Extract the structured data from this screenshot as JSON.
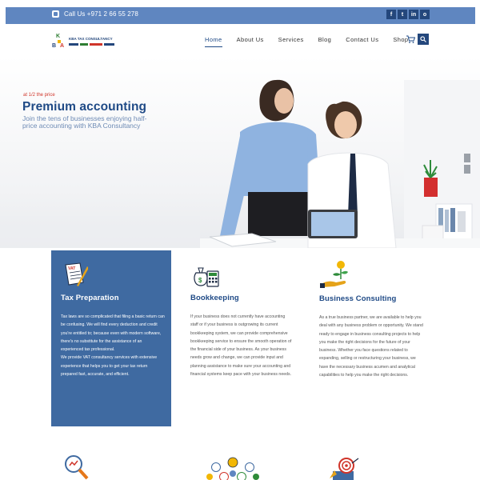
{
  "topbar": {
    "phone": "Call Us +971 2 66 55 278",
    "socials": [
      "facebook-icon",
      "twitter-icon",
      "linkedin-icon",
      "instagram-icon"
    ],
    "social_glyphs": [
      "f",
      "t",
      "in",
      "o"
    ]
  },
  "header": {
    "logo_name": "KBA TAX CONSULTANCY",
    "logo_letters": "K B A",
    "nav": [
      "Home",
      "About Us",
      "Services",
      "Blog",
      "Contact Us",
      "Shop"
    ],
    "active_nav": "Home"
  },
  "hero": {
    "kicker": "at 1/2 the price",
    "title": "Premium accounting",
    "subtitle": "Join the tens of businesses enjoying half-price accounting with KBA Consultancy"
  },
  "cards": {
    "tax": {
      "title": "Tax Preparation",
      "icon_label": "VAT",
      "p1": "Tax laws are so complicated that filing a basic return can be confusing. We will find every deduction and credit you're entitled to; because even with modern software, there's no substitute for the assistance of an experienced tax professional.",
      "p2": "We provide VAT consultancy services with extensive experience that helps you to get your tax return prepared fast, accurate, and efficient."
    },
    "book": {
      "title": "Bookkeeping",
      "body": "If your business does not currently have accounting staff or if your business is outgrowing its current bookkeeping system, we can provide comprehensive bookkeeping service to ensure the smooth operation of the financial side of your business. As your business needs grow and change, we can provide input and planning assistance to make sure your accounting and financial systems keep pace with your business needs."
    },
    "biz": {
      "title": "Business Consulting",
      "body": "As a true business partner, we are available to help you deal with any business problem or opportunity. We stand ready to engage in business consulting projects to help you make the right decisions for the future of your business. Whether you face questions related to expanding, selling or restructuring your business, we have the necessary business acumen and analytical capabilities to help you make the right decisions."
    }
  },
  "colors": {
    "topbar": "#5f86c0",
    "brand": "#1f4a86",
    "tax_card": "#3f6aa1",
    "accent_red": "#d0352a"
  }
}
